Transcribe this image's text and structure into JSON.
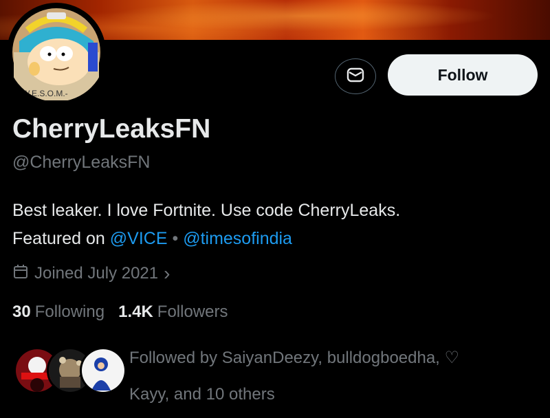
{
  "profile": {
    "display_name": "CherryLeaksFN",
    "handle": "@CherryLeaksFN",
    "bio_line1": "Best leaker. I love Fortnite. Use code CherryLeaks.",
    "bio_featured": "Featured on",
    "bio_link1": "@VICE",
    "bio_separator": "•",
    "bio_link2": "@timesofindia",
    "joined": "Joined July 2021",
    "joined_chevron": "›",
    "avatar_text": "W.E.S.O.M.-"
  },
  "actions": {
    "message_icon": "message-icon",
    "follow_label": "Follow"
  },
  "stats": {
    "following_count": "30",
    "following_label": "Following",
    "followers_count": "1.4K",
    "followers_label": "Followers"
  },
  "followed_by": {
    "line1": "Followed by SaiyanDeezy, bulldogboedha, ♡",
    "line2": "Kayy, and 10 others"
  },
  "colors": {
    "link": "#1d9bf0",
    "secondary_text": "#71767b",
    "primary_text": "#e7e9ea",
    "follow_bg": "#eff3f4"
  }
}
